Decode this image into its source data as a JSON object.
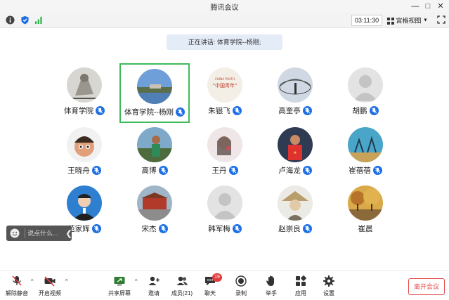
{
  "window": {
    "title": "腾讯会议"
  },
  "infobar": {
    "timer": "03:11:30",
    "view_label": "宫格视图"
  },
  "speaking": {
    "text": "正在讲话: 体育学院--杨刚;"
  },
  "participants": [
    {
      "name": "体育学院",
      "avatar": "sketch-portrait",
      "mic": "muted",
      "active": false
    },
    {
      "name": "体育学院--杨刚",
      "avatar": "lake-landscape",
      "mic": "muted",
      "active": true
    },
    {
      "name": "朱银飞",
      "avatar": "china-youth-logo",
      "mic": "muted",
      "active": false
    },
    {
      "name": "高奎亭",
      "avatar": "stadium-photo",
      "mic": "muted",
      "active": false
    },
    {
      "name": "胡鹏",
      "avatar": "default-avatar",
      "mic": "muted",
      "active": false
    },
    {
      "name": "王晓舟",
      "avatar": "cartoon-boy",
      "mic": "muted",
      "active": false
    },
    {
      "name": "高博",
      "avatar": "person-outdoors",
      "mic": "muted",
      "active": false
    },
    {
      "name": "王丹",
      "avatar": "woman-selfie",
      "mic": "muted",
      "active": false
    },
    {
      "name": "卢海龙",
      "avatar": "athlete-photo",
      "mic": "muted",
      "active": false
    },
    {
      "name": "崔蓓蓓",
      "avatar": "volleyball-photo",
      "mic": "muted",
      "active": false
    },
    {
      "name": "范家辉",
      "avatar": "student-portrait",
      "mic": "muted",
      "active": false
    },
    {
      "name": "宋杰",
      "avatar": "tiananmen-photo",
      "mic": "muted",
      "active": false
    },
    {
      "name": "韩军梅",
      "avatar": "default-avatar",
      "mic": "muted",
      "active": false
    },
    {
      "name": "赵崇良",
      "avatar": "straw-hat-sketch",
      "mic": "muted",
      "active": false
    },
    {
      "name": "崔晨",
      "avatar": "autumn-trees",
      "mic": "none",
      "active": false
    }
  ],
  "chat": {
    "placeholder": "说点什么..."
  },
  "toolbar": {
    "unmute": "解除静音",
    "video": "开启视频",
    "share": "共享屏幕",
    "invite": "邀请",
    "members": "成员(21)",
    "chat": "聊天",
    "chat_badge": "19",
    "record": "录制",
    "raise_hand": "举手",
    "apps": "应用",
    "settings": "设置",
    "leave": "离开会议"
  },
  "colors": {
    "accent": "#1e6fe6",
    "active_border": "#3fba5a",
    "danger": "#e24a4a"
  }
}
